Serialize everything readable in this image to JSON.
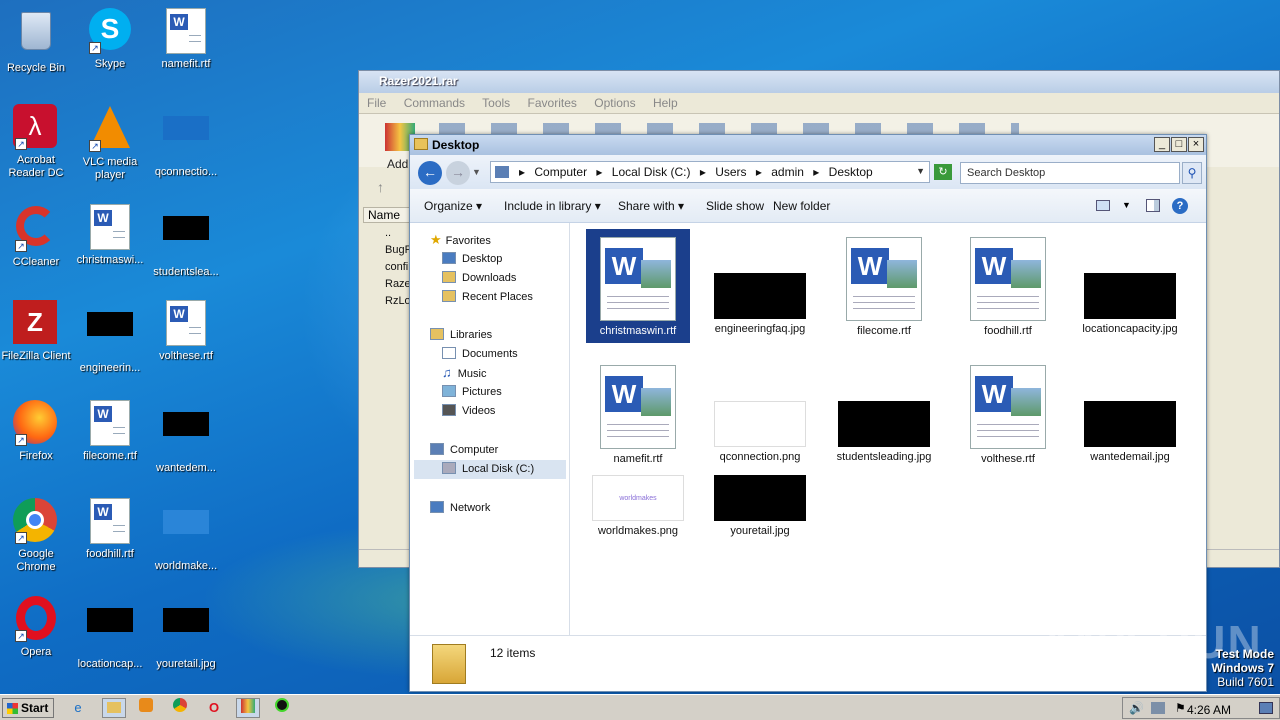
{
  "desktop": {
    "icons": [
      {
        "label": "Recycle Bin"
      },
      {
        "label": "Skype"
      },
      {
        "label": "namefit.rtf"
      },
      {
        "label": "Acrobat Reader DC"
      },
      {
        "label": "VLC media player"
      },
      {
        "label": "qconnectio..."
      },
      {
        "label": "CCleaner"
      },
      {
        "label": "christmaswi..."
      },
      {
        "label": "studentslea..."
      },
      {
        "label": "FileZilla Client"
      },
      {
        "label": "engineerin..."
      },
      {
        "label": "volthese.rtf"
      },
      {
        "label": "Firefox"
      },
      {
        "label": "filecome.rtf"
      },
      {
        "label": "wantedem..."
      },
      {
        "label": "Google Chrome"
      },
      {
        "label": "foodhill.rtf"
      },
      {
        "label": "worldmake..."
      },
      {
        "label": "Opera"
      },
      {
        "label": "locationcap..."
      },
      {
        "label": "youretail.jpg"
      }
    ]
  },
  "rar_window": {
    "title": "Razer2021.rar",
    "menu": [
      "File",
      "Commands",
      "Tools",
      "Favorites",
      "Options",
      "Help"
    ],
    "add_label": "Add",
    "column_name": "Name",
    "files": [
      "..",
      "BugR",
      "confi",
      "Raze",
      "RzLo"
    ]
  },
  "explorer": {
    "title": "Desktop",
    "breadcrumb": [
      "Computer",
      "Local Disk (C:)",
      "Users",
      "admin",
      "Desktop"
    ],
    "search_placeholder": "Search Desktop",
    "commands": [
      "Organize",
      "Include in library",
      "Share with",
      "Slide show",
      "New folder"
    ],
    "nav": {
      "favorites": "Favorites",
      "desktop": "Desktop",
      "downloads": "Downloads",
      "recent": "Recent Places",
      "libraries": "Libraries",
      "documents": "Documents",
      "music": "Music",
      "pictures": "Pictures",
      "videos": "Videos",
      "computer": "Computer",
      "local_disk": "Local Disk (C:)",
      "network": "Network"
    },
    "files": [
      {
        "name": "christmaswin.rtf"
      },
      {
        "name": "engineeringfaq.jpg"
      },
      {
        "name": "filecome.rtf"
      },
      {
        "name": "foodhill.rtf"
      },
      {
        "name": "locationcapacity.jpg"
      },
      {
        "name": "namefit.rtf"
      },
      {
        "name": "qconnection.png"
      },
      {
        "name": "studentsleading.jpg"
      },
      {
        "name": "volthese.rtf"
      },
      {
        "name": "wantedemail.jpg"
      },
      {
        "name": "worldmakes.png"
      },
      {
        "name": "youretail.jpg"
      }
    ],
    "thumb_text": {
      "worldmakes": "worldmakes"
    },
    "item_count": "12 items"
  },
  "watermark": "ANY RUN",
  "test_mode": {
    "line1": "Test Mode",
    "line2": "Windows 7",
    "line3": "Build 7601"
  },
  "taskbar": {
    "start": "Start",
    "clock": "4:26 AM"
  }
}
